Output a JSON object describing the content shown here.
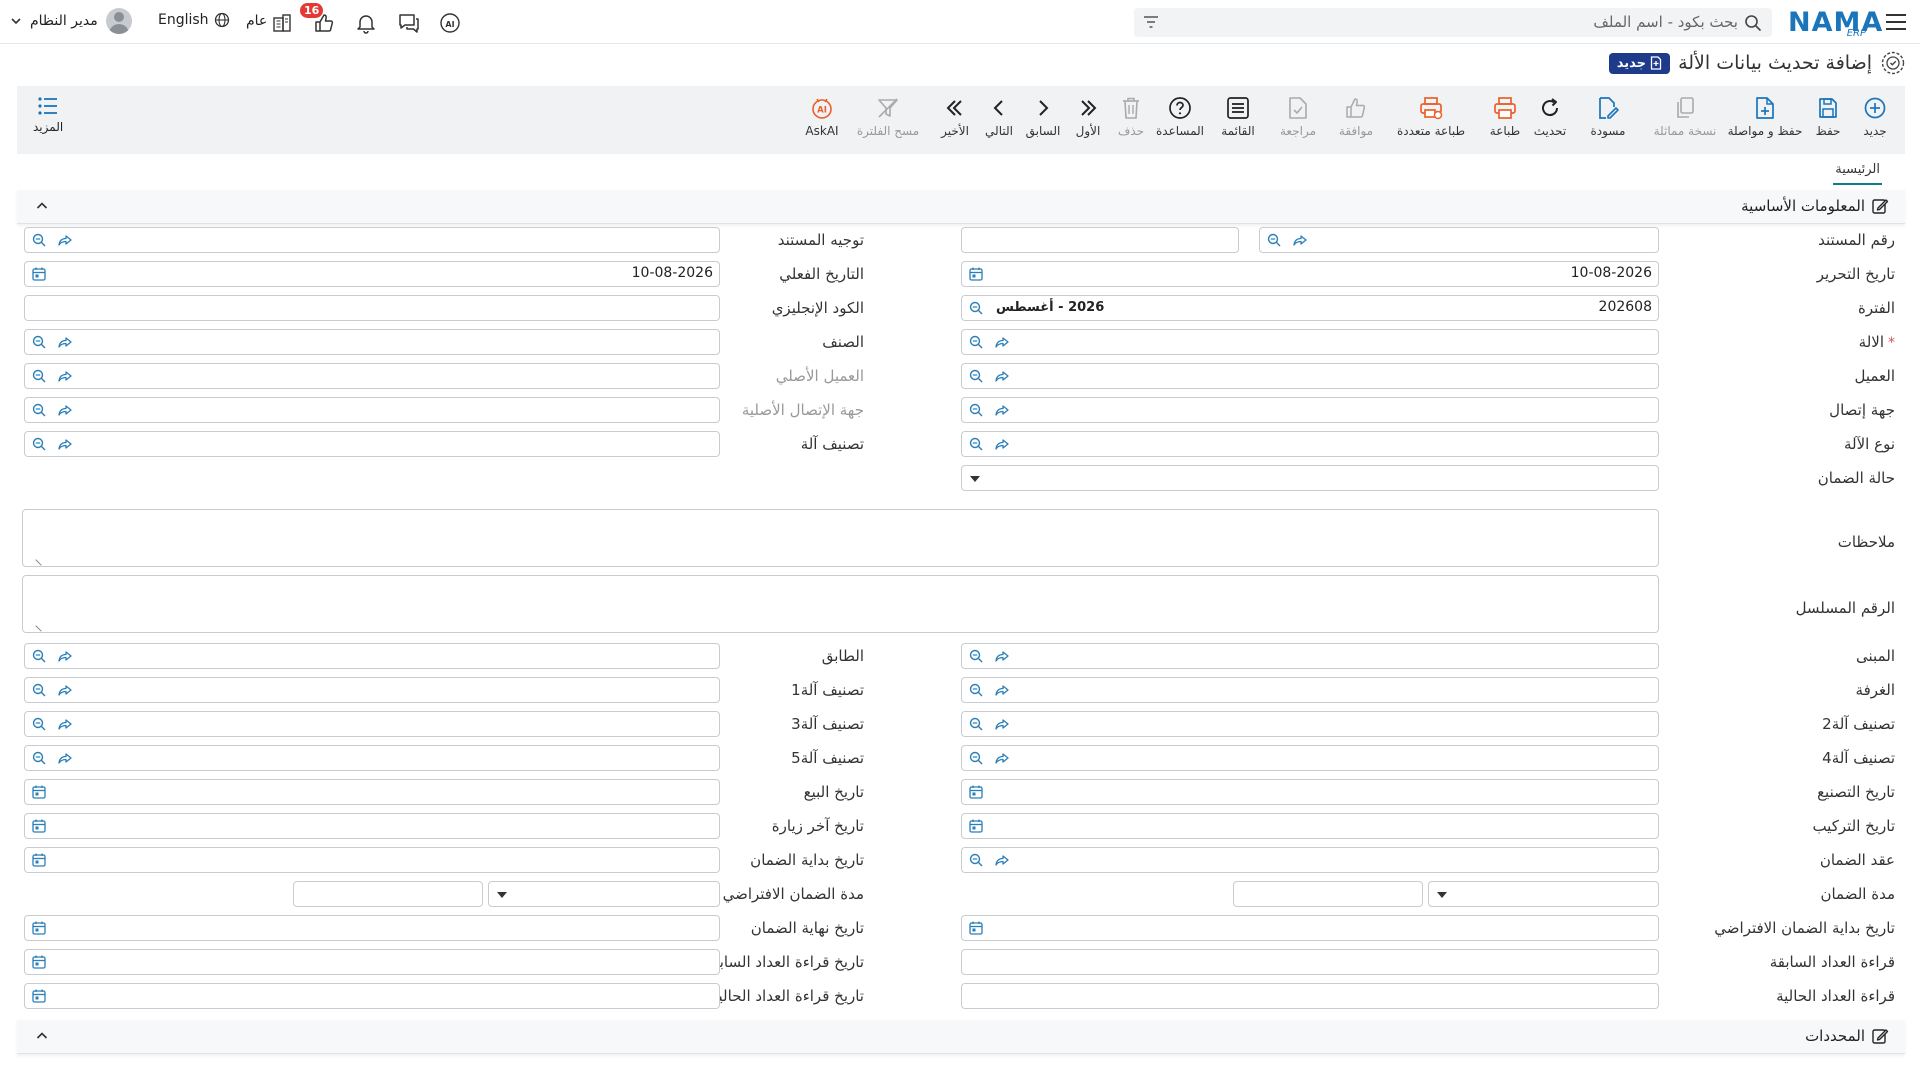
{
  "header": {
    "logo_main": "NAMA",
    "logo_sub": "ERP",
    "search_placeholder": "بحث بكود - اسم الملف",
    "notifications_count": "16",
    "general_label": "عام",
    "language": "English",
    "user_name": "مدير النظام"
  },
  "page": {
    "title": "إضافة تحديث بيانات الألة",
    "status_badge": "جديد"
  },
  "toolbar": {
    "new": "جديد",
    "save": "حفظ",
    "save_continue": "حفظ و مواصلة",
    "copy": "نسخة مماثلة",
    "draft": "مسودة",
    "refresh": "تحديث",
    "print": "طباعة",
    "multi_print": "طباعة متعددة",
    "approve": "موافقة",
    "review": "مراجعة",
    "list": "القائمة",
    "help": "المساعدة",
    "delete": "حذف",
    "first": "الأول",
    "prev": "السابق",
    "next": "التالي",
    "last": "الأخير",
    "clear_filter": "مسح الفلترة",
    "askai": "AskAI",
    "more": "المزيد"
  },
  "tabs": {
    "main": "الرئيسية"
  },
  "sections": {
    "basic": "المعلومات الأساسية",
    "determinants": "المحددات"
  },
  "form": {
    "doc_number": "رقم المستند",
    "doc_direction": "توجيه المستند",
    "edit_date": "تاريخ التحرير",
    "edit_date_value": "10-08-2026",
    "actual_date": "التاريخ الفعلي",
    "actual_date_value": "10-08-2026",
    "period": "الفترة",
    "period_value": "202608",
    "period_label": "2026 - أغسطس",
    "english_code": "الكود الإنجليزي",
    "machine": "الالة",
    "required_mark": "*",
    "item": "الصنف",
    "customer": "العميل",
    "original_customer": "العميل الأصلي",
    "contact": "جهة إتصال",
    "original_contact": "جهة الإتصال الأصلية",
    "machine_type": "نوع الآلة",
    "machine_class": "تصنيف آلة",
    "warranty_status": "حالة الضمان",
    "notes": "ملاحظات",
    "serial_number": "الرقم المسلسل",
    "building": "المبنى",
    "floor": "الطابق",
    "room": "الغرفة",
    "machine_class1": "تصنيف آلة1",
    "machine_class2": "تصنيف آلة2",
    "machine_class3": "تصنيف آلة3",
    "machine_class4": "تصنيف آلة4",
    "machine_class5": "تصنيف آلة5",
    "manufacture_date": "تاريخ التصنيع",
    "sale_date": "تاريخ البيع",
    "install_date": "تاريخ التركيب",
    "last_visit_date": "تاريخ آخر زيارة",
    "warranty_contract": "عقد الضمان",
    "warranty_start_date": "تاريخ بداية الضمان",
    "warranty_period": "مدة الضمان",
    "default_warranty_period": "مدة الضمان الافتراضي",
    "default_warranty_start": "تاريخ بداية الضمان الافتراضي",
    "warranty_end_date": "تاريخ نهاية الضمان",
    "prev_meter": "قراءة العداد السابقة",
    "prev_meter_date": "تاريخ قراءة العداد السابقة",
    "current_meter": "قراءة العداد الحالية",
    "current_meter_date": "تاريخ قراءة العداد الحالية"
  },
  "colors": {
    "brand": "#1b75bb",
    "accent": "#0f7c8a",
    "badge": "#e53935",
    "print": "#e8612c"
  }
}
